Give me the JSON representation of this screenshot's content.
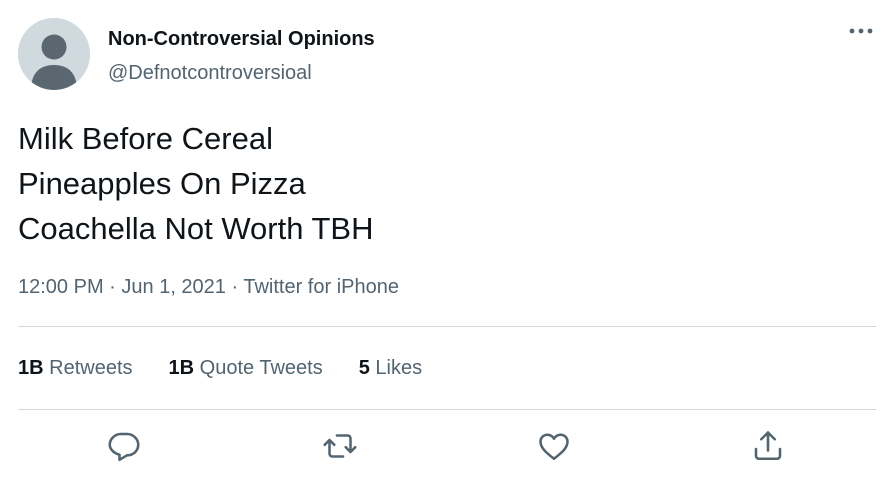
{
  "user": {
    "name": "Non-Controversial Opinions",
    "handle": "@Defnotcontroversioal"
  },
  "tweet": {
    "lines": [
      "Milk Before Cereal",
      "Pineapples On Pizza",
      "Coachella Not Worth TBH"
    ],
    "time": "12:00 PM",
    "date": "Jun 1, 2021",
    "source": "Twitter for iPhone",
    "separator": " · "
  },
  "stats": {
    "retweets_count": "1B",
    "retweets_label": "Retweets",
    "quote_count": "1B",
    "quote_label": "Quote Tweets",
    "likes_count": "5",
    "likes_label": "Likes"
  },
  "icons": {
    "more": "more-horizontal-icon",
    "reply": "reply-icon",
    "retweet": "retweet-icon",
    "like": "heart-icon",
    "share": "share-icon"
  },
  "colors": {
    "text": "#0f1419",
    "secondary": "#536471",
    "divider": "#cfd9de",
    "avatar_bg": "#cfd9de",
    "avatar_fg": "#5b6770"
  }
}
